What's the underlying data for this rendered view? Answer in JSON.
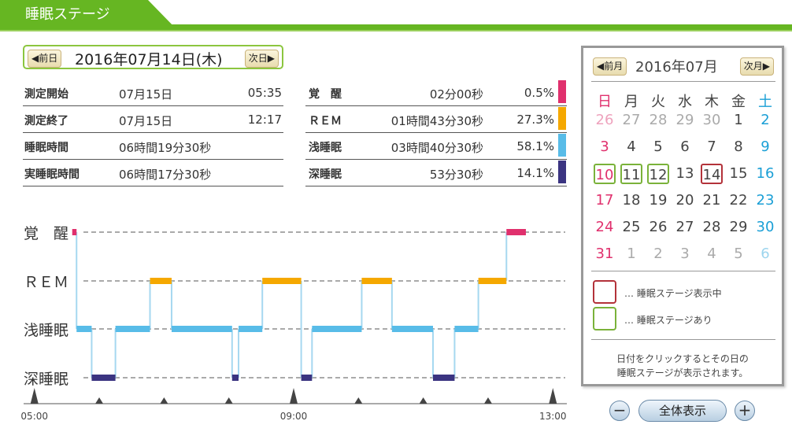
{
  "header": {
    "title": "睡眠ステージ"
  },
  "datebar": {
    "prev": "◀前日",
    "date": "2016年07月14日(木)",
    "next": "次日▶"
  },
  "stats_left": [
    {
      "key": "測定開始",
      "date": "07月15日",
      "time": "05:35"
    },
    {
      "key": "測定終了",
      "date": "07月15日",
      "time": "12:17"
    },
    {
      "key": "睡眠時間",
      "date": "06時間19分30秒",
      "time": ""
    },
    {
      "key": "実睡眠時間",
      "date": "06時間17分30秒",
      "time": ""
    }
  ],
  "stats_right": [
    {
      "key": "覚　醒",
      "dur": "02分00秒",
      "pct": "0.5%",
      "color": "#e0306d"
    },
    {
      "key": "ＲＥＭ",
      "dur": "01時間43分30秒",
      "pct": "27.3%",
      "color": "#f5a800"
    },
    {
      "key": "浅睡眠",
      "dur": "03時間40分30秒",
      "pct": "58.1%",
      "color": "#58bce8"
    },
    {
      "key": "深睡眠",
      "dur": "53分30秒",
      "pct": "14.1%",
      "color": "#3b3481"
    }
  ],
  "chart_data": {
    "type": "step",
    "stages": [
      "覚　醒",
      "ＲＥＭ",
      "浅睡眠",
      "深睡眠"
    ],
    "x_ticks": [
      "05:00",
      "09:00",
      "13:00"
    ],
    "x_range": [
      "04:50",
      "13:10"
    ],
    "colors": {
      "覚　醒": "#e0306d",
      "ＲＥＭ": "#f5a800",
      "浅睡眠": "#58bce8",
      "深睡眠": "#3b3481"
    },
    "segments": [
      {
        "stage": "覚　醒",
        "start": "05:35",
        "end": "05:39"
      },
      {
        "stage": "浅睡眠",
        "start": "05:39",
        "end": "05:53"
      },
      {
        "stage": "深睡眠",
        "start": "05:53",
        "end": "06:15"
      },
      {
        "stage": "浅睡眠",
        "start": "06:15",
        "end": "06:47"
      },
      {
        "stage": "ＲＥＭ",
        "start": "06:47",
        "end": "07:07"
      },
      {
        "stage": "浅睡眠",
        "start": "07:07",
        "end": "08:03"
      },
      {
        "stage": "深睡眠",
        "start": "08:03",
        "end": "08:09"
      },
      {
        "stage": "浅睡眠",
        "start": "08:09",
        "end": "08:31"
      },
      {
        "stage": "ＲＥＭ",
        "start": "08:31",
        "end": "09:07"
      },
      {
        "stage": "深睡眠",
        "start": "09:07",
        "end": "09:17"
      },
      {
        "stage": "浅睡眠",
        "start": "09:17",
        "end": "10:03"
      },
      {
        "stage": "ＲＥＭ",
        "start": "10:03",
        "end": "10:31"
      },
      {
        "stage": "浅睡眠",
        "start": "10:31",
        "end": "11:09"
      },
      {
        "stage": "深睡眠",
        "start": "11:09",
        "end": "11:29"
      },
      {
        "stage": "浅睡眠",
        "start": "11:29",
        "end": "11:51"
      },
      {
        "stage": "ＲＥＭ",
        "start": "11:51",
        "end": "12:17"
      },
      {
        "stage": "覚　醒",
        "start": "12:17",
        "end": "12:35"
      }
    ]
  },
  "calendar": {
    "prev": "◀前月",
    "month": "2016年07月",
    "next": "次月▶",
    "weekdays": [
      "日",
      "月",
      "火",
      "水",
      "木",
      "金",
      "土"
    ],
    "weeks": [
      [
        "26",
        "27",
        "28",
        "29",
        "30",
        "1",
        "2"
      ],
      [
        "3",
        "4",
        "5",
        "6",
        "7",
        "8",
        "9"
      ],
      [
        "10",
        "11",
        "12",
        "13",
        "14",
        "15",
        "16"
      ],
      [
        "17",
        "18",
        "19",
        "20",
        "21",
        "22",
        "23"
      ],
      [
        "24",
        "25",
        "26",
        "27",
        "28",
        "29",
        "30"
      ],
      [
        "31",
        "1",
        "2",
        "3",
        "4",
        "5",
        "6"
      ]
    ],
    "selected": "14",
    "has_data": [
      "10",
      "11",
      "12"
    ],
    "legend_selected": "… 睡眠ステージ表示中",
    "legend_data": "… 睡眠ステージあり",
    "note_line1": "日付をクリックするとその日の",
    "note_line2": "睡眠ステージが表示されます。"
  },
  "zoom": {
    "minus": "−",
    "all": "全体表示",
    "plus": "+"
  }
}
